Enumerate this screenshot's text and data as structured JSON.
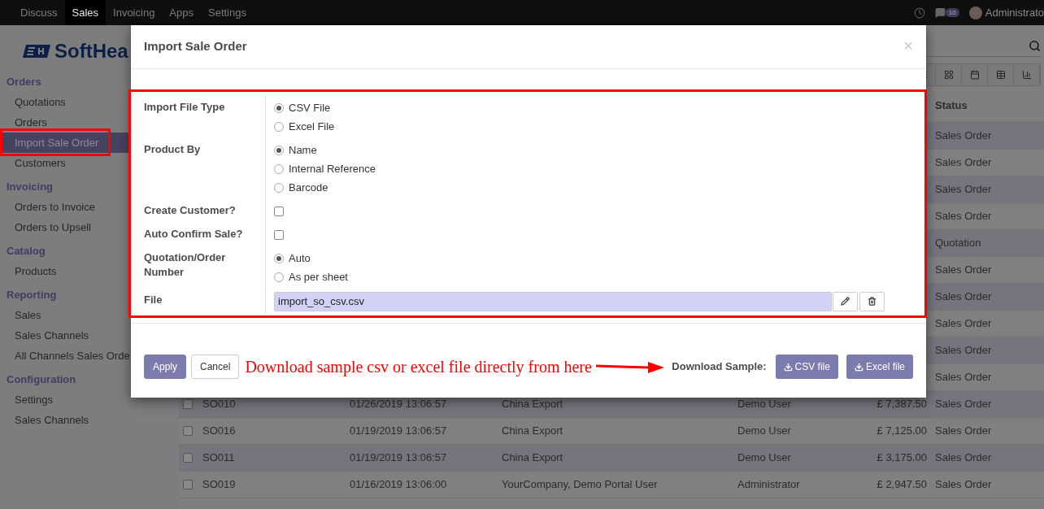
{
  "top_nav": {
    "menu": [
      {
        "label": "Discuss",
        "selected": false
      },
      {
        "label": "Sales",
        "selected": true
      },
      {
        "label": "Invoicing",
        "selected": false
      },
      {
        "label": "Apps",
        "selected": false
      },
      {
        "label": "Settings",
        "selected": false
      }
    ],
    "messages_badge": "10",
    "user": "Administrato"
  },
  "sidebar": {
    "logo": "SoftHea",
    "sections": [
      {
        "title": "Orders",
        "items": [
          {
            "label": "Quotations",
            "selected": false
          },
          {
            "label": "Orders",
            "selected": false
          },
          {
            "label": "Import Sale Order",
            "selected": true
          },
          {
            "label": "Customers",
            "selected": false
          }
        ]
      },
      {
        "title": "Invoicing",
        "items": [
          {
            "label": "Orders to Invoice",
            "selected": false
          },
          {
            "label": "Orders to Upsell",
            "selected": false
          }
        ]
      },
      {
        "title": "Catalog",
        "items": [
          {
            "label": "Products",
            "selected": false
          }
        ]
      },
      {
        "title": "Reporting",
        "items": [
          {
            "label": "Sales",
            "selected": false
          },
          {
            "label": "Sales Channels",
            "selected": false
          },
          {
            "label": "All Channels Sales Orde",
            "selected": false
          }
        ]
      },
      {
        "title": "Configuration",
        "items": [
          {
            "label": "Settings",
            "selected": false
          },
          {
            "label": "Sales Channels",
            "selected": false
          }
        ]
      }
    ]
  },
  "table": {
    "columns": [
      "Status"
    ],
    "rows": [
      {
        "status": "Sales Order"
      },
      {
        "status": "Sales Order"
      },
      {
        "status": "Sales Order"
      },
      {
        "status": "Sales Order"
      },
      {
        "status": "Quotation"
      },
      {
        "status": "Sales Order"
      },
      {
        "status": "Sales Order"
      },
      {
        "status": "Sales Order"
      },
      {
        "status": "Sales Order"
      },
      {
        "status": "Sales Order"
      },
      {
        "checked": false,
        "number": "SO010",
        "date": "01/26/2019 13:06:57",
        "customer": "China Export",
        "salesperson": "Demo User",
        "total": "£ 7,387.50",
        "status": "Sales Order"
      },
      {
        "checked": false,
        "number": "SO016",
        "date": "01/19/2019 13:06:57",
        "customer": "China Export",
        "salesperson": "Demo User",
        "total": "£ 7,125.00",
        "status": "Sales Order"
      },
      {
        "checked": false,
        "number": "SO011",
        "date": "01/19/2019 13:06:57",
        "customer": "China Export",
        "salesperson": "Demo User",
        "total": "£ 3,175.00",
        "status": "Sales Order"
      },
      {
        "checked": false,
        "number": "SO019",
        "date": "01/16/2019 13:06:00",
        "customer": "YourCompany, Demo Portal User",
        "salesperson": "Administrator",
        "total": "£ 2,947.50",
        "status": "Sales Order"
      }
    ]
  },
  "dialog": {
    "title": "Import Sale Order",
    "close": "×",
    "fields": [
      {
        "label": "Import File Type",
        "kind": "radio",
        "options": [
          {
            "label": "CSV File",
            "selected": true
          },
          {
            "label": "Excel File",
            "selected": false
          }
        ]
      },
      {
        "label": "Product By",
        "kind": "radio",
        "options": [
          {
            "label": "Name",
            "selected": true
          },
          {
            "label": "Internal Reference",
            "selected": false
          },
          {
            "label": "Barcode",
            "selected": false
          }
        ]
      },
      {
        "label": "Create Customer?",
        "kind": "checkbox",
        "checked": false
      },
      {
        "label": "Auto Confirm Sale?",
        "kind": "checkbox",
        "checked": false
      },
      {
        "label": "Quotation/Order Number",
        "kind": "radio",
        "options": [
          {
            "label": "Auto",
            "selected": true
          },
          {
            "label": "As per sheet",
            "selected": false
          }
        ]
      },
      {
        "label": "File",
        "kind": "file",
        "value": "import_so_csv.csv"
      }
    ],
    "buttons": [
      {
        "label": "Apply",
        "kind": "primary"
      },
      {
        "label": "Cancel",
        "kind": "secondary"
      }
    ],
    "annotation": "Download sample csv or excel file directly from here",
    "download": {
      "label": "Download Sample:",
      "buttons": [
        "CSV file",
        "Excel file"
      ]
    }
  }
}
